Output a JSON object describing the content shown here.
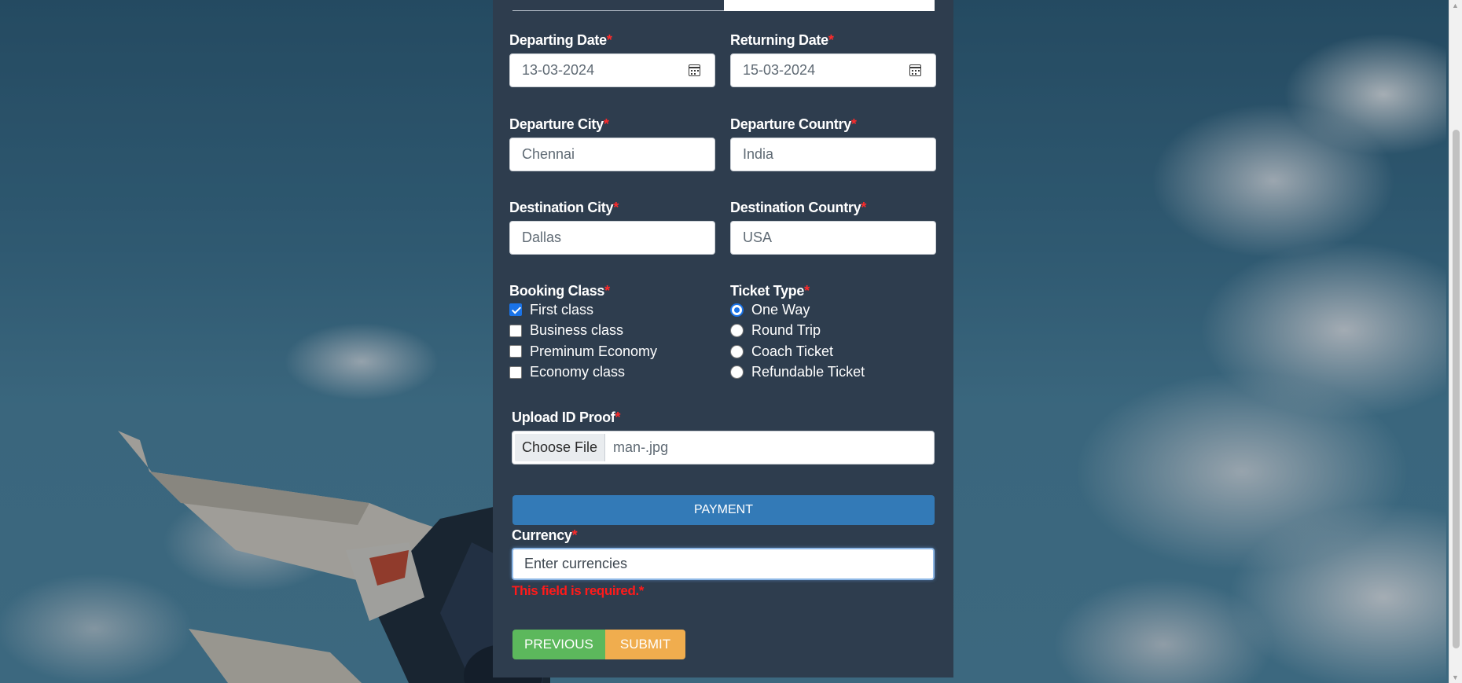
{
  "form": {
    "departing_date": {
      "label": "Departing Date",
      "value": "13-03-2024"
    },
    "returning_date": {
      "label": "Returning Date",
      "value": "15-03-2024"
    },
    "departure_city": {
      "label": "Departure City",
      "value": "Chennai"
    },
    "departure_country": {
      "label": "Departure Country",
      "value": "India"
    },
    "destination_city": {
      "label": "Destination City",
      "value": "Dallas"
    },
    "destination_country": {
      "label": "Destination Country",
      "value": "USA"
    },
    "required_mark": "*",
    "booking_class": {
      "label": "Booking Class",
      "options": [
        {
          "label": "First class",
          "checked": true
        },
        {
          "label": "Business class",
          "checked": false
        },
        {
          "label": "Preminum Economy",
          "checked": false
        },
        {
          "label": "Economy class",
          "checked": false
        }
      ]
    },
    "ticket_type": {
      "label": "Ticket Type",
      "options": [
        {
          "label": "One Way",
          "selected": true
        },
        {
          "label": "Round Trip",
          "selected": false
        },
        {
          "label": "Coach Ticket",
          "selected": false
        },
        {
          "label": "Refundable Ticket",
          "selected": false
        }
      ]
    },
    "upload_id": {
      "label": "Upload ID Proof",
      "button": "Choose File",
      "file_name": "man-.jpg"
    },
    "payment_section": "PAYMENT",
    "currency": {
      "label": "Currency",
      "placeholder": "Enter currencies",
      "error": "This field is required.*"
    },
    "buttons": {
      "previous": "PREVIOUS",
      "submit": "SUBMIT"
    }
  },
  "colors": {
    "panel": "#2e3d4e",
    "required": "#ff2a2a",
    "payment_bar": "#337ab7",
    "previous_button": "#5cb85c",
    "submit_button": "#f0ad4e",
    "selected_control": "#1a73e8"
  }
}
